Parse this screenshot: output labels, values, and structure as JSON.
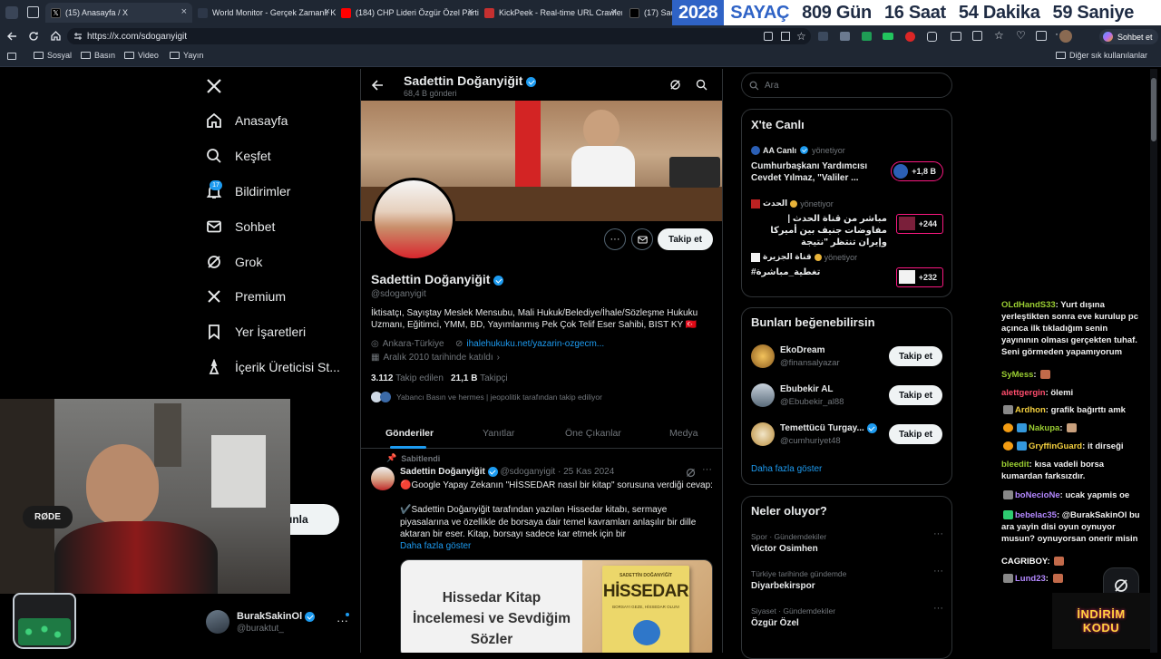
{
  "browser": {
    "tabs": [
      {
        "label": "(15) Anasayfa / X",
        "icon": "x-favicon",
        "color": "#000000"
      },
      {
        "label": "World Monitor - Gerçek Zamanlı K",
        "icon": "globe-favicon",
        "color": "#2d3748"
      },
      {
        "label": "(184) CHP Lideri Özgür Özel Partis",
        "icon": "youtube-favicon",
        "color": "#ff0000"
      },
      {
        "label": "KickPeek - Real-time URL Crawler",
        "icon": "kickpeek-favicon",
        "color": "#c53030"
      },
      {
        "label": "(17) Sade",
        "icon": "x-favicon",
        "color": "#000000"
      }
    ],
    "url": "https://x.com/sdoganyigit",
    "bookmarks": [
      "Sosyal",
      "Basın",
      "Video",
      "Yayın"
    ],
    "other_bookmarks": "Diğer sık kullanılanlar",
    "chat_button": "Sohbet et"
  },
  "overlay_counter": {
    "year": "2028",
    "label": "SAYAÇ",
    "days": "809 Gün",
    "hours": "16 Saat",
    "minutes": "54 Dakika",
    "seconds": "59 Saniye"
  },
  "sidebar": {
    "items": [
      {
        "label": "Anasayfa",
        "icon": "home-icon"
      },
      {
        "label": "Keşfet",
        "icon": "search-icon"
      },
      {
        "label": "Bildirimler",
        "icon": "bell-icon",
        "badge": "17"
      },
      {
        "label": "Sohbet",
        "icon": "mail-icon"
      },
      {
        "label": "Grok",
        "icon": "grok-icon"
      },
      {
        "label": "Premium",
        "icon": "x-icon"
      },
      {
        "label": "Yer İşaretleri",
        "icon": "bookmark-icon"
      },
      {
        "label": "İçerik Üreticisi St...",
        "icon": "creator-icon"
      }
    ],
    "post_button_fragment": "ınla",
    "account": {
      "name": "BurakSakinOl",
      "handle": "@buraktut_"
    }
  },
  "profile": {
    "header_name": "Sadettin Doğanyiğit",
    "post_count": "68,4 B gönderi",
    "name": "Sadettin Doğanyiğit",
    "handle": "@sdoganyigit",
    "bio": "İktisatçı, Sayıştay Meslek Mensubu, Mali Hukuk/Belediye/İhale/Sözleşme Hukuku Uzmanı, Eğitimci, YMM, BD, Yayımlanmış Pek Çok Telif Eser Sahibi, BIST KY 🇹🇷",
    "location": "Ankara-Türkiye",
    "website": "ihalehukuku.net/yazarin-ozgecm...",
    "joined": "Aralık 2010 tarihinde katıldı",
    "following_count": "3.112",
    "following_label": "Takip edilen",
    "followers_count": "21,1 B",
    "followers_label": "Takipçi",
    "followed_by": "Yabancı Basın ve hermes | jeopolitik tarafından takip ediliyor",
    "follow_button": "Takip et",
    "tabs": [
      "Gönderiler",
      "Yanıtlar",
      "Öne Çıkanlar",
      "Medya"
    ]
  },
  "pinned_post": {
    "pinned_label": "Sabitlendi",
    "author": "Sadettin Doğanyiğit",
    "handle": "@sdoganyigit",
    "date": "· 25 Kas 2024",
    "text1": "🔴Google Yapay Zekanın \"HİSSEDAR nasıl bir kitap\" sorusuna verdiği cevap:",
    "text2": "✔️Sadettin Doğanyiğit tarafından yazılan Hissedar kitabı, sermaye piyasalarına ve özellikle de borsaya dair temel kavramları anlaşılır bir dille aktaran bir eser. Kitap, borsayı sadece kar etmek için bir",
    "show_more": "Daha fazla göster",
    "image_title": "Hissedar Kitap İncelemesi ve Sevdiğim Sözler",
    "book_author": "SADETTİN DOĞANYİĞİT",
    "book_title": "HİSSEDAR",
    "book_subtitle": "BORSAYI GEZE, HİSSEDAR OLUN!"
  },
  "search": {
    "placeholder": "Ara"
  },
  "live": {
    "title": "X'te Canlı",
    "items": [
      {
        "host": "AA Canlı",
        "role": "yönetiyor",
        "title": "Cumhurbaşkanı Yardımcısı Cevdet Yılmaz, \"Valiler ...",
        "count": "+1,8 B"
      },
      {
        "host": "الحدث",
        "role": "yönetiyor",
        "title": "مباشر من قناة الحدث | مفاوضات جنيف بين أميركا وإيران تنتظر \"نتيجة",
        "count": "+244"
      },
      {
        "host": "قناة الجزيرة",
        "role": "yönetiyor",
        "title": "#تغطية_مباشرة",
        "count": "+232"
      }
    ]
  },
  "suggestions": {
    "title": "Bunları beğenebilirsin",
    "items": [
      {
        "name": "EkoDream",
        "handle": "@finansalyazar",
        "button": "Takip et"
      },
      {
        "name": "Ebubekir AL",
        "handle": "@Ebubekir_al88",
        "button": "Takip et"
      },
      {
        "name": "Temettücü Turgay...",
        "handle": "@cumhuriyet48",
        "button": "Takip et"
      }
    ],
    "show_more": "Daha fazla göster"
  },
  "trends": {
    "title": "Neler oluyor?",
    "items": [
      {
        "context": "Spor · Gündemdekiler",
        "name": "Victor Osimhen"
      },
      {
        "context": "Türkiye tarihinde gündemde",
        "name": "Diyarbekirspor"
      },
      {
        "context": "Siyaset · Gündemdekiler",
        "name": "Özgür Özel"
      }
    ]
  },
  "stream_chat": [
    {
      "user": "OLdHandS33",
      "color": "#9acd32",
      "text": "Yurt dışına yerleştikten sonra eve kurulup pc açınca ilk tıkladığım senin yayınının olması gerçekten tuhaf. Seni görmeden yapamıyorum"
    },
    {
      "user": "SyMess",
      "color": "#9acd32",
      "text": ""
    },
    {
      "user": "alettgergin",
      "color": "#ff4d6d",
      "text": "ölemi"
    },
    {
      "user": "Ardhon",
      "color": "#f4d03f",
      "text": "grafik bağırttı amk"
    },
    {
      "user": "Nakupa",
      "color": "#9acd32",
      "text": ""
    },
    {
      "user": "GryffinGuard",
      "color": "#f4d03f",
      "text": "it dirseği"
    },
    {
      "user": "bleedit",
      "color": "#9acd32",
      "text": "kısa vadeli borsa kumardan farksızdır."
    },
    {
      "user": "boNecioNe",
      "color": "#b388ff",
      "text": "ucak yapmis oe"
    },
    {
      "user": "bebelac35",
      "color": "#b388ff",
      "text": "@BurakSakinOl bu ara yayin disi oyun oynuyor musun? oynuyorsan onerir misin"
    },
    {
      "user": "CAGRIBOY",
      "color": "#ffffff",
      "text": ""
    },
    {
      "user": "Lund23",
      "color": "#b388ff",
      "text": ""
    }
  ],
  "promo": {
    "line1": "İNDİRİM",
    "line2": "KODU"
  },
  "webcam": {
    "mic_brand": "RØDE"
  }
}
